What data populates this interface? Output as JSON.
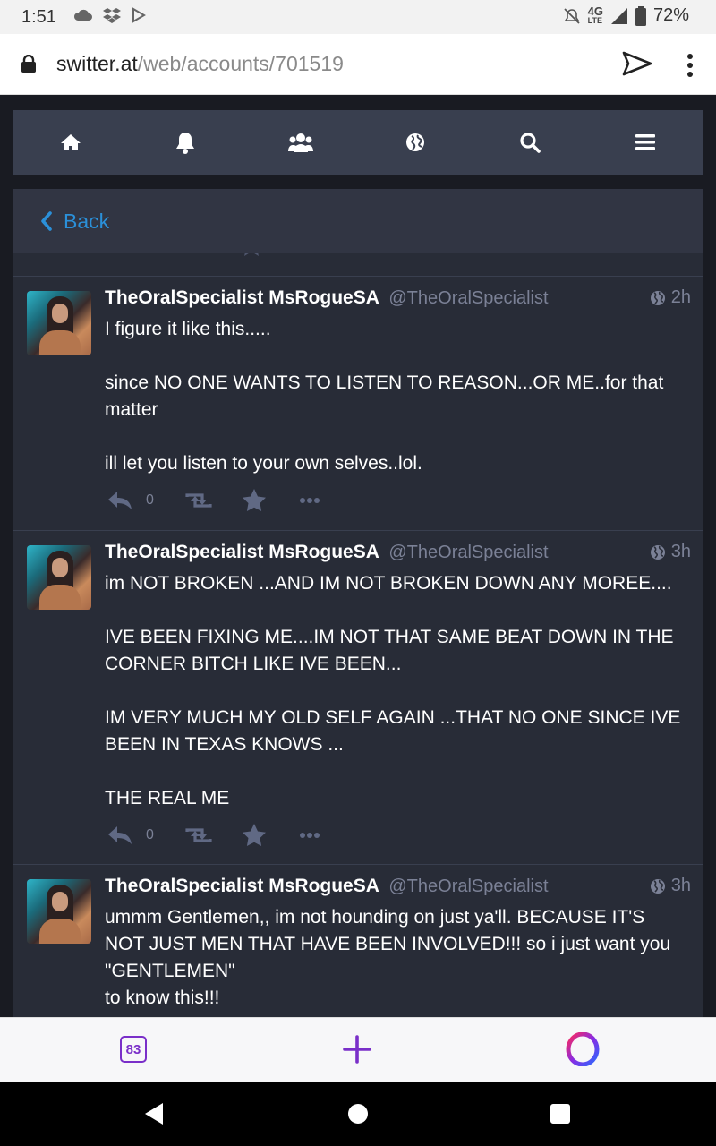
{
  "statusbar": {
    "time": "1:51",
    "network": "4G",
    "network_sub": "LTE",
    "battery": "72%"
  },
  "browser": {
    "url_domain": "switter.at",
    "url_path": "/web/accounts/701519",
    "tabs_count": "83"
  },
  "header": {
    "back_label": "Back"
  },
  "colors": {
    "accent": "#2b90d9",
    "background": "#282c37",
    "nav": "#393f4f",
    "muted": "#7b8196"
  },
  "statuses": [
    {
      "display_name": "TheOralSpecialist MsRogueSA",
      "acct": "@TheOralSpecialist",
      "time": "2h",
      "paragraphs": [
        "I figure it like this.....",
        "since NO ONE WANTS TO LISTEN TO REASON...OR ME..for that matter",
        "ill let you listen to your own selves..lol."
      ],
      "replies": "0"
    },
    {
      "display_name": "TheOralSpecialist MsRogueSA",
      "acct": "@TheOralSpecialist",
      "time": "3h",
      "paragraphs": [
        "im NOT BROKEN ...AND IM NOT BROKEN DOWN ANY MOREE....",
        "IVE BEEN FIXING ME....IM NOT THAT SAME BEAT DOWN IN THE CORNER  BITCH LIKE IVE BEEN...",
        "IM VERY MUCH MY OLD SELF AGAIN ...THAT NO ONE SINCE IVE BEEN IN TEXAS  KNOWS ...",
        "THE REAL ME"
      ],
      "replies": "0"
    },
    {
      "display_name": "TheOralSpecialist MsRogueSA",
      "acct": "@TheOralSpecialist",
      "time": "3h",
      "paragraphs": [
        "ummm Gentlemen,, im not hounding on just ya'll. BECAUSE IT'S NOT JUST MEN THAT HAVE BEEN INVOLVED!!! so i just want you \"GENTLEMEN\"\nto know this!!!"
      ],
      "replies": ""
    }
  ]
}
